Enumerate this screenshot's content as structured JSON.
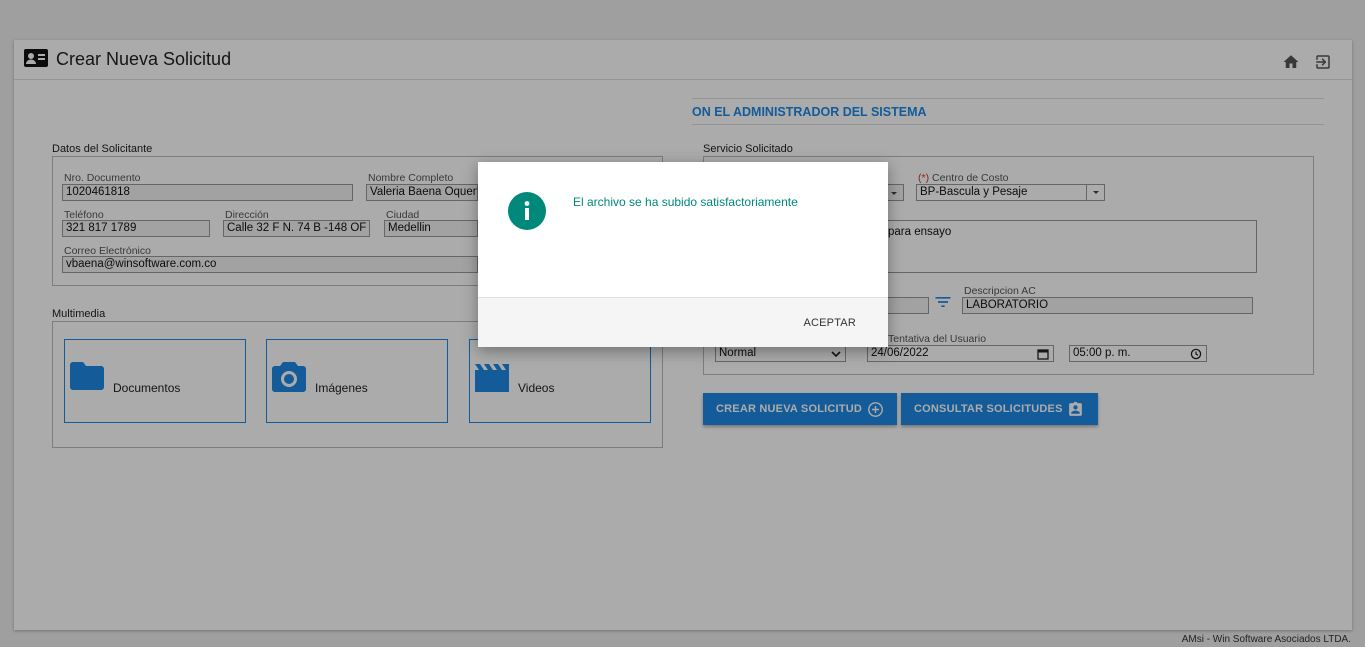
{
  "header": {
    "title": "Crear Nueva Solicitud",
    "home_icon": "home-icon",
    "logout_icon": "exit-icon"
  },
  "banner": {
    "text": "ON EL ADMINISTRADOR DEL SISTEMA"
  },
  "solicitante": {
    "section_label": "Datos del Solicitante",
    "documento": {
      "label": "Nro. Documento",
      "value": "1020461818"
    },
    "nombre": {
      "label": "Nombre Completo",
      "value": "Valeria Baena Oquendo"
    },
    "telefono": {
      "label": "Teléfono",
      "value": "321 817 1789"
    },
    "direccion": {
      "label": "Dirección",
      "value": "Calle 32 F N. 74 B -148 OF 201"
    },
    "ciudad": {
      "label": "Ciudad",
      "value": "Medellin"
    },
    "correo": {
      "label": "Correo Electrónico",
      "value": "vbaena@winsoftware.com.co"
    }
  },
  "multimedia": {
    "section_label": "Multimedia",
    "items": [
      {
        "label": "Documentos",
        "icon": "folder-icon"
      },
      {
        "label": "Imágenes",
        "icon": "camera-icon"
      },
      {
        "label": "Videos",
        "icon": "movie-icon"
      }
    ]
  },
  "servicio": {
    "section_label": "Servicio Solicitado",
    "centro_costo": {
      "required_mark": "(*)",
      "label": "Centro de Costo",
      "value": "BP-Bascula y Pesaje"
    },
    "descripcion_text": "para ensayo",
    "descripcion_ac": {
      "label": "Descripcion AC",
      "value": "LABORATORIO"
    },
    "fecha_tentativa": {
      "label": "Tentativa del Usuario"
    },
    "prioridad": {
      "value": "Normal"
    },
    "fecha": {
      "value": "24/06/2022"
    },
    "hora": {
      "value": "05:00 p. m."
    }
  },
  "buttons": {
    "crear": "CREAR NUEVA SOLICITUD",
    "consultar": "CONSULTAR SOLICITUDES"
  },
  "footer": {
    "text": "AMsi - Win Software Asociados LTDA."
  },
  "modal": {
    "message": "El archivo se ha subido satisfactoriamente",
    "accept": "ACEPTAR",
    "icon": "info-icon"
  },
  "colors": {
    "accent": "#1e88e5",
    "success": "#00897b",
    "required": "#d32f2f"
  }
}
